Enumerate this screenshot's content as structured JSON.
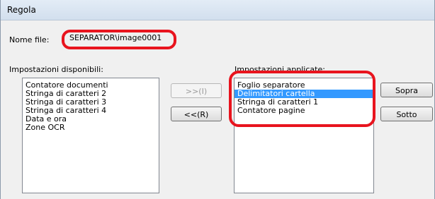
{
  "window": {
    "title": "Regola"
  },
  "filename": {
    "label": "Nome file:",
    "value": "SEPARATOR\\image0001"
  },
  "available": {
    "label": "Impostazioni disponibili:",
    "items": [
      "Contatore documenti",
      "Stringa di caratteri 2",
      "Stringa di caratteri 3",
      "Stringa di caratteri 4",
      "Data e ora",
      "Zone OCR"
    ]
  },
  "applied": {
    "label": "Impostazioni applicate:",
    "items": [
      "Foglio separatore",
      "Delimitatori cartella",
      "Stringa di caratteri 1",
      "Contatore pagine"
    ],
    "selected": "Delimitatori cartella"
  },
  "buttons": {
    "add": ">>(I)",
    "remove": "<<(R)",
    "up": "Sopra",
    "down": "Sotto"
  },
  "colors": {
    "highlight": "#e8141e",
    "selection": "#3399ff"
  }
}
